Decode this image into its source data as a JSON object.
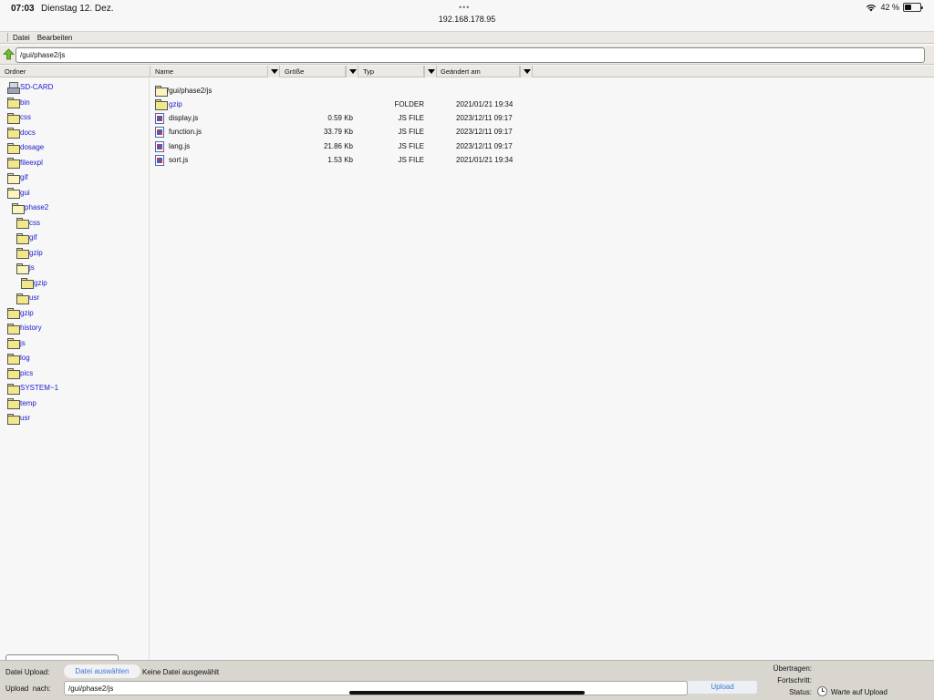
{
  "status_bar": {
    "time": "07:03",
    "date": "Dienstag 12. Dez.",
    "url": "192.168.178.95",
    "battery": "42 %",
    "battery_level": 0.42
  },
  "menu": {
    "items": [
      "Datei",
      "Bearbeiten"
    ]
  },
  "address": {
    "path": "/gui/phase2/js"
  },
  "columns": {
    "folder": "Ordner",
    "name": "Name",
    "size": "Größe",
    "type": "Typ",
    "modified": "Geändert am"
  },
  "tree": [
    {
      "label": "SD-CARD",
      "icon": "sd-card-icon",
      "level": 0
    },
    {
      "label": "bin",
      "icon": "folder-icon",
      "level": 0
    },
    {
      "label": "css",
      "icon": "folder-icon",
      "level": 0
    },
    {
      "label": "docs",
      "icon": "folder-icon",
      "level": 0
    },
    {
      "label": "dosage",
      "icon": "folder-icon",
      "level": 0
    },
    {
      "label": "fileexpl",
      "icon": "folder-icon",
      "level": 0
    },
    {
      "label": "gif",
      "icon": "folder-open-icon",
      "level": 0
    },
    {
      "label": "gui",
      "icon": "folder-open-icon",
      "level": 0
    },
    {
      "label": "phase2",
      "icon": "folder-open-icon",
      "level": 1
    },
    {
      "label": "css",
      "icon": "folder-icon",
      "level": 2
    },
    {
      "label": "gif",
      "icon": "folder-icon",
      "level": 2
    },
    {
      "label": "gzip",
      "icon": "folder-icon",
      "level": 2
    },
    {
      "label": "js",
      "icon": "folder-open-icon",
      "level": 2
    },
    {
      "label": "gzip",
      "icon": "folder-icon",
      "level": 3
    },
    {
      "label": "usr",
      "icon": "folder-icon",
      "level": 2
    },
    {
      "label": "gzip",
      "icon": "folder-icon",
      "level": 0
    },
    {
      "label": "history",
      "icon": "folder-icon",
      "level": 0
    },
    {
      "label": "js",
      "icon": "folder-icon",
      "level": 0
    },
    {
      "label": "log",
      "icon": "folder-icon",
      "level": 0
    },
    {
      "label": "pics",
      "icon": "folder-icon",
      "level": 0
    },
    {
      "label": "SYSTEM~1",
      "icon": "folder-icon",
      "level": 0
    },
    {
      "label": "temp",
      "icon": "folder-icon",
      "level": 0
    },
    {
      "label": "usr",
      "icon": "folder-icon",
      "level": 0
    }
  ],
  "files": {
    "current": "/gui/phase2/js",
    "rows": [
      {
        "name": "gzip",
        "size": "",
        "type": "FOLDER",
        "modified": "2021/01/21 19:34",
        "icon": "folder-icon",
        "link": true
      },
      {
        "name": "display.js",
        "size": "0.59 Kb",
        "type": "JS FILE",
        "modified": "2023/12/11 09:17",
        "icon": "js-file-icon",
        "link": false
      },
      {
        "name": "function.js",
        "size": "33.79 Kb",
        "type": "JS FILE",
        "modified": "2023/12/11 09:17",
        "icon": "js-file-icon",
        "link": false
      },
      {
        "name": "lang.js",
        "size": "21.86 Kb",
        "type": "JS FILE",
        "modified": "2023/12/11 09:17",
        "icon": "js-file-icon",
        "link": false
      },
      {
        "name": "sort.js",
        "size": "1.53 Kb",
        "type": "JS FILE",
        "modified": "2021/01/21 19:34",
        "icon": "js-file-icon",
        "link": false
      }
    ]
  },
  "upload": {
    "file_label": "Datei Upload:",
    "choose_label": "Datei auswählen",
    "no_file": "Keine Datei ausgewählt",
    "target_label": "Upload  nach:",
    "target_path": "/gui/phase2/js",
    "button": "Upload",
    "transferred_label": "Übertragen:",
    "progress_label": "Fortschritt:",
    "status_label": "Status:",
    "status_text": "Warte auf Upload"
  },
  "colors": {
    "link": "#1a1ad0",
    "button_text": "#3978d8",
    "chrome": "#ece9e4"
  }
}
